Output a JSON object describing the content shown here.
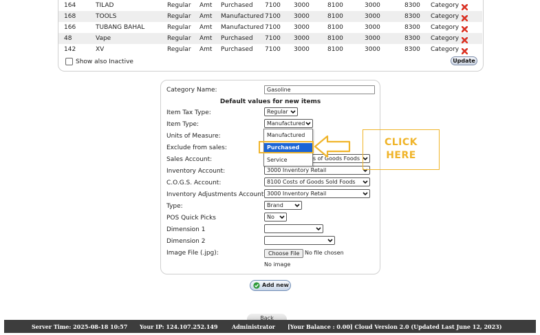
{
  "table": {
    "rows": [
      {
        "id": "164",
        "name": "TILAD",
        "tax": "Regular",
        "units": "Amt",
        "type": "Purchased",
        "sales": "7100",
        "inv": "3000",
        "cogs": "8100",
        "adj": "3000",
        "dim": "8300",
        "category": "Category"
      },
      {
        "id": "168",
        "name": "TOOLS",
        "tax": "Regular",
        "units": "Amt",
        "type": "Manufactured",
        "sales": "7100",
        "inv": "3000",
        "cogs": "8100",
        "adj": "3000",
        "dim": "8300",
        "category": "Category"
      },
      {
        "id": "166",
        "name": "TUBANG BAHAL",
        "tax": "Regular",
        "units": "Amt",
        "type": "Manufactured",
        "sales": "7100",
        "inv": "3000",
        "cogs": "8100",
        "adj": "3000",
        "dim": "8300",
        "category": "Category"
      },
      {
        "id": "48",
        "name": "Vape",
        "tax": "Regular",
        "units": "Amt",
        "type": "Purchased",
        "sales": "7100",
        "inv": "3000",
        "cogs": "8100",
        "adj": "3000",
        "dim": "8300",
        "category": "Category"
      },
      {
        "id": "142",
        "name": "XV",
        "tax": "Regular",
        "units": "Amt",
        "type": "Purchased",
        "sales": "7100",
        "inv": "3000",
        "cogs": "8100",
        "adj": "3000",
        "dim": "8300",
        "category": "Category"
      }
    ],
    "show_inactive_label": "Show also Inactive",
    "update_label": "Update"
  },
  "form": {
    "category_name_label": "Category Name:",
    "category_name_value": "Gasoline",
    "section_title": "Default values for new items",
    "item_tax_type_label": "Item Tax Type:",
    "item_tax_type_value": "Regular",
    "item_type_label": "Item Type:",
    "item_type_value": "Manufactured",
    "units_label": "Units of Measure:",
    "exclude_label": "Exclude from sales:",
    "sales_account_label": "Sales Account:",
    "sales_account_value": "es of Goods Foods",
    "inventory_account_label": "Inventory Account:",
    "inventory_account_value": "3000   Inventory Retail",
    "cogs_account_label": "C.O.G.S. Account:",
    "cogs_account_value": "8100   Costs of Goods Sold Foods",
    "inv_adj_label": "Inventory Adjustments Account:",
    "inv_adj_value": "3000   Inventory Retail",
    "type_label": "Type:",
    "type_value": "Brand",
    "pos_label": "POS Quick Picks",
    "pos_value": "No",
    "dim1_label": "Dimension 1",
    "dim1_value": "",
    "dim2_label": "Dimension 2",
    "dim2_value": "",
    "image_label": "Image File (.jpg):",
    "choose_file": "Choose File",
    "no_file": "No file chosen",
    "no_image": "No image"
  },
  "dropdown": {
    "options": [
      "Manufactured",
      "Purchased",
      "Service"
    ],
    "selected": "Purchased"
  },
  "annotation": {
    "line1": "CLICK",
    "line2": "HERE",
    "color": "#f0b429"
  },
  "add_new_label": "Add new",
  "back_label": "Back",
  "footer": {
    "server_time": "Server Time: 2025-08-18 10:57",
    "ip": "Your IP: 124.107.252.149",
    "user": "Administrator",
    "balance": "[Your Balance : 0.00] Cloud Version 2.0 (Updated Last June 12, 2023)"
  }
}
